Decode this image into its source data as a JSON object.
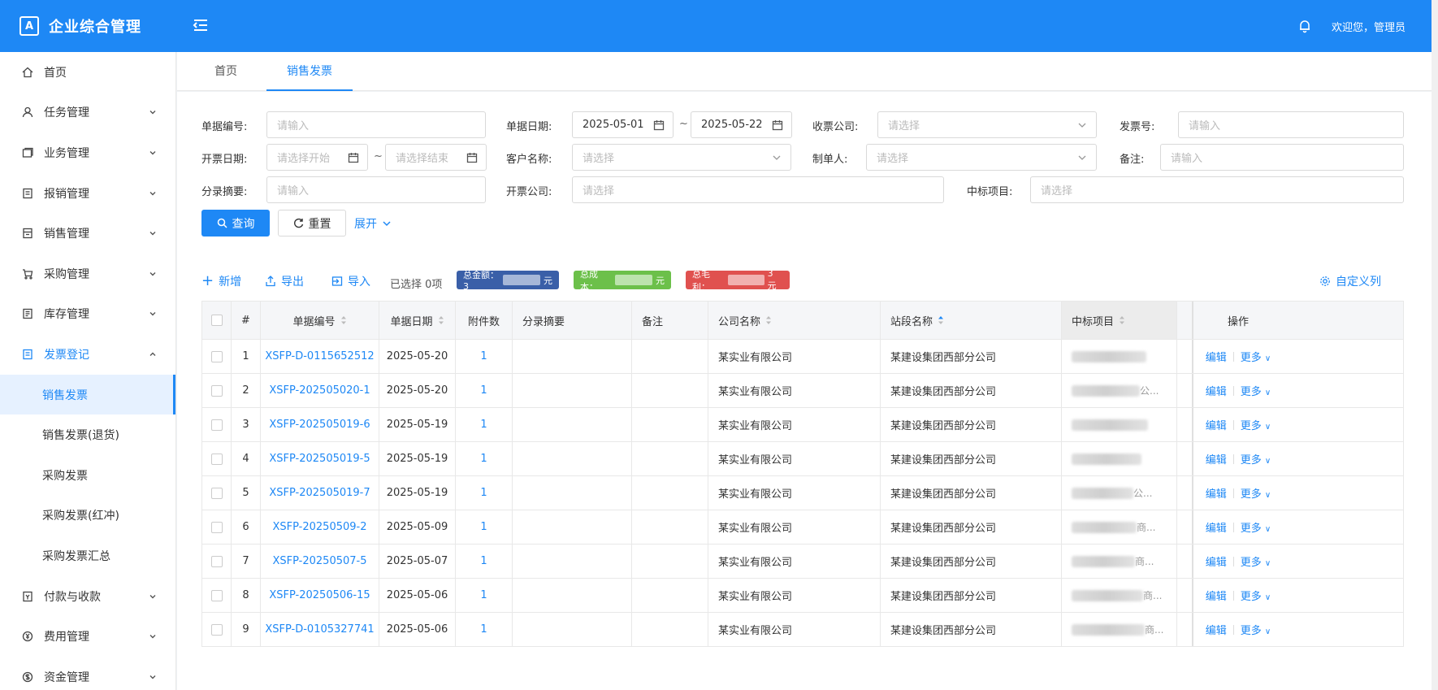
{
  "header": {
    "brand_logo_text": "A",
    "brand_title": "企业综合管理",
    "welcome": "欢迎您，管理员"
  },
  "sidebar": {
    "items": [
      {
        "label": "首页",
        "icon": "home-icon",
        "expandable": false
      },
      {
        "label": "任务管理",
        "icon": "user-icon",
        "expandable": true
      },
      {
        "label": "业务管理",
        "icon": "window-icon",
        "expandable": true
      },
      {
        "label": "报销管理",
        "icon": "document-icon",
        "expandable": true
      },
      {
        "label": "销售管理",
        "icon": "calculator-icon",
        "expandable": true
      },
      {
        "label": "采购管理",
        "icon": "cart-icon",
        "expandable": true
      },
      {
        "label": "库存管理",
        "icon": "list-icon",
        "expandable": true
      },
      {
        "label": "发票登记",
        "icon": "invoice-icon",
        "expandable": true,
        "open": true
      },
      {
        "label": "付款与收款",
        "icon": "payment-icon",
        "expandable": true
      },
      {
        "label": "费用管理",
        "icon": "yen-icon",
        "expandable": true
      },
      {
        "label": "资金管理",
        "icon": "dollar-icon",
        "expandable": true
      }
    ],
    "sub_items": [
      "销售发票",
      "销售发票(退货)",
      "采购发票",
      "采购发票(红冲)",
      "采购发票汇总"
    ]
  },
  "tabs": [
    "首页",
    "销售发票"
  ],
  "filters": {
    "doc_no_label": "单据编号:",
    "doc_no_placeholder": "请输入",
    "doc_date_label": "单据日期:",
    "doc_date_start": "2025-05-01",
    "doc_date_end": "2025-05-22",
    "receive_company_label": "收票公司:",
    "receive_company_placeholder": "请选择",
    "invoice_no_label": "发票号:",
    "invoice_no_placeholder": "请输入",
    "invoice_date_label": "开票日期:",
    "invoice_date_start_placeholder": "请选择开始",
    "invoice_date_end_placeholder": "请选择结束",
    "customer_label": "客户名称:",
    "customer_placeholder": "请选择",
    "maker_label": "制单人:",
    "maker_placeholder": "请选择",
    "remark_label": "备注:",
    "remark_placeholder": "请输入",
    "summary_label": "分录摘要:",
    "summary_placeholder": "请输入",
    "issuer_label": "开票公司:",
    "issuer_placeholder": "请选择",
    "project_label": "中标项目:",
    "project_placeholder": "请选择",
    "search_label": "查询",
    "reset_label": "重置",
    "expand_label": "展开"
  },
  "toolbar": {
    "add_label": "新增",
    "export_label": "导出",
    "import_label": "导入",
    "selected_text": "已选择 0项",
    "total_amount_label": "总金额：3",
    "total_amount_unit": "元",
    "total_cost_label": "总成本：",
    "total_cost_unit": "元",
    "total_profit_label": "总毛利：",
    "total_profit_unit": "3 元",
    "custom_columns_label": "自定义列",
    "colors": {
      "amount": "#3a5fa8",
      "cost": "#6cc04a",
      "profit": "#e0514f"
    }
  },
  "table": {
    "headers": {
      "index": "#",
      "doc_no": "单据编号",
      "doc_date": "单据日期",
      "attachments": "附件数",
      "summary": "分录摘要",
      "remark": "备注",
      "company": "公司名称",
      "section": "站段名称",
      "project": "中标项目",
      "actions": "操作"
    },
    "edit_label": "编辑",
    "more_label": "更多",
    "rows": [
      {
        "index": "1",
        "doc_no": "XSFP-D-0115652512",
        "date": "2025-05-20",
        "att": "1",
        "company": "某实业有限公司",
        "section": "某建设集团西部分公司",
        "project_suffix": ""
      },
      {
        "index": "2",
        "doc_no": "XSFP-202505020-1",
        "date": "2025-05-20",
        "att": "1",
        "company": "某实业有限公司",
        "section": "某建设集团西部分公司",
        "project_suffix": "公..."
      },
      {
        "index": "3",
        "doc_no": "XSFP-202505019-6",
        "date": "2025-05-19",
        "att": "1",
        "company": "某实业有限公司",
        "section": "某建设集团西部分公司",
        "project_suffix": ""
      },
      {
        "index": "4",
        "doc_no": "XSFP-202505019-5",
        "date": "2025-05-19",
        "att": "1",
        "company": "某实业有限公司",
        "section": "某建设集团西部分公司",
        "project_suffix": ""
      },
      {
        "index": "5",
        "doc_no": "XSFP-202505019-7",
        "date": "2025-05-19",
        "att": "1",
        "company": "某实业有限公司",
        "section": "某建设集团西部分公司",
        "project_suffix": "公..."
      },
      {
        "index": "6",
        "doc_no": "XSFP-20250509-2",
        "date": "2025-05-09",
        "att": "1",
        "company": "某实业有限公司",
        "section": "某建设集团西部分公司",
        "project_suffix": "商..."
      },
      {
        "index": "7",
        "doc_no": "XSFP-20250507-5",
        "date": "2025-05-07",
        "att": "1",
        "company": "某实业有限公司",
        "section": "某建设集团西部分公司",
        "project_suffix": "商..."
      },
      {
        "index": "8",
        "doc_no": "XSFP-20250506-15",
        "date": "2025-05-06",
        "att": "1",
        "company": "某实业有限公司",
        "section": "某建设集团西部分公司",
        "project_suffix": "商..."
      },
      {
        "index": "9",
        "doc_no": "XSFP-D-0105327741",
        "date": "2025-05-06",
        "att": "1",
        "company": "某实业有限公司",
        "section": "某建设集团西部分公司",
        "project_suffix": "商..."
      }
    ]
  }
}
